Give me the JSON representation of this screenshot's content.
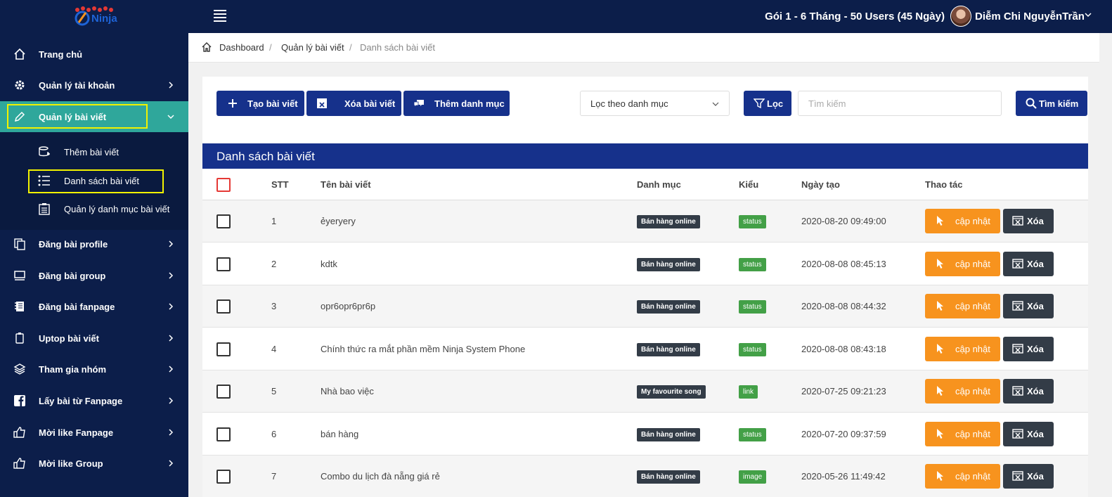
{
  "header": {
    "logo_text": "Ninja",
    "plan": "Gói 1 - 6 Tháng - 50 Users (45 Ngày)",
    "user_name": "Diễm Chi NguyễnTrần"
  },
  "sidebar": {
    "items": [
      {
        "label": "Trang chủ",
        "icon": "home-icon"
      },
      {
        "label": "Quản lý tài khoản",
        "icon": "gear-icon"
      },
      {
        "label": "Quản lý bài viết",
        "icon": "pencil-icon"
      },
      {
        "label": "Đăng bài profile",
        "icon": "copy-icon"
      },
      {
        "label": "Đăng bài group",
        "icon": "group-post-icon"
      },
      {
        "label": "Đăng bài fanpage",
        "icon": "notebook-icon"
      },
      {
        "label": "Uptop bài viết",
        "icon": "clipboard-icon"
      },
      {
        "label": "Tham gia nhóm",
        "icon": "layers-icon"
      },
      {
        "label": "Lấy bài từ Fanpage",
        "icon": "facebook-icon"
      },
      {
        "label": "Mời like Fanpage",
        "icon": "thumbs-up-icon"
      },
      {
        "label": "Mời like Group",
        "icon": "thumbs-up-icon"
      }
    ],
    "submenu": [
      {
        "label": "Thêm bài viết",
        "icon": "add-post-icon"
      },
      {
        "label": "Danh sách bài viết",
        "icon": "list-icon"
      },
      {
        "label": "Quản lý danh mục bài viết",
        "icon": "clipboard-list-icon"
      }
    ]
  },
  "breadcrumb": [
    "Dashboard",
    "Quản lý bài viết",
    "Danh sách bài viết"
  ],
  "toolbar": {
    "create_label": "Tạo bài viết",
    "delete_label": "Xóa bài viết",
    "add_category_label": "Thêm danh mục",
    "filter_select_value": "Lọc theo danh mục",
    "filter_label": "Lọc",
    "search_placeholder": "Tìm kiếm",
    "search_label": "Tìm kiếm"
  },
  "table": {
    "title": "Danh sách bài viết",
    "columns": [
      "STT",
      "Tên bài viết",
      "Danh mục",
      "Kiểu",
      "Ngày tạo",
      "Thao tác"
    ],
    "update_label": "cập nhật",
    "delete_label": "Xóa",
    "rows": [
      {
        "stt": "1",
        "name": "ẻyeryery",
        "category": "Bán hàng online",
        "type": "status",
        "date": "2020-08-20 09:49:00"
      },
      {
        "stt": "2",
        "name": "kdtk",
        "category": "Bán hàng online",
        "type": "status",
        "date": "2020-08-08 08:45:13"
      },
      {
        "stt": "3",
        "name": "opr6opr6pr6p",
        "category": "Bán hàng online",
        "type": "status",
        "date": "2020-08-08 08:44:32"
      },
      {
        "stt": "4",
        "name": "Chính thức ra mắt phần mềm Ninja System Phone",
        "category": "Bán hàng online",
        "type": "status",
        "date": "2020-08-08 08:43:18"
      },
      {
        "stt": "5",
        "name": "Nhà bao việc",
        "category": "My favourite song",
        "type": "link",
        "date": "2020-07-25 09:21:23"
      },
      {
        "stt": "6",
        "name": "bán hàng",
        "category": "Bán hàng online",
        "type": "status",
        "date": "2020-07-20 09:37:59"
      },
      {
        "stt": "7",
        "name": "Combo du lịch đà nẵng giá rẻ",
        "category": "Bán hàng online",
        "type": "image",
        "date": "2020-05-26 11:49:42"
      }
    ]
  },
  "colors": {
    "navy": "#0c1e4a",
    "primary": "#16318b",
    "active_teal": "#2fa79b",
    "orange": "#f7931e",
    "dark": "#333c47",
    "green": "#43a047",
    "highlight": "#f2f200"
  }
}
